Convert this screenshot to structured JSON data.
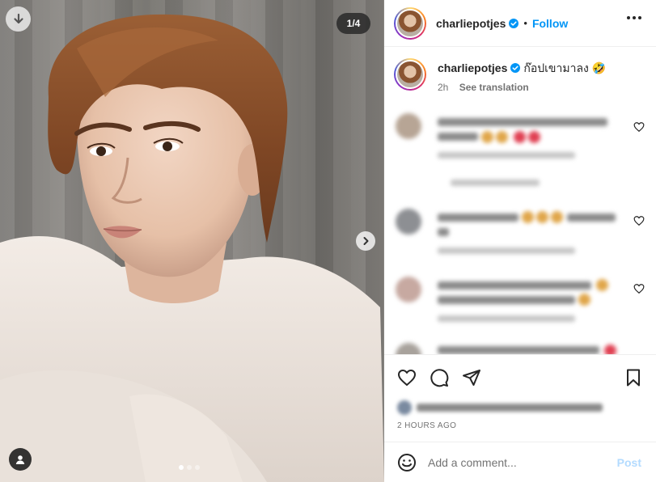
{
  "media": {
    "counter": "1/4",
    "carousel": {
      "total": 4,
      "active_index": 0
    },
    "icons": [
      "download-icon",
      "chevron-right-icon",
      "user-tag-icon"
    ]
  },
  "post": {
    "username": "charliepotjes",
    "separator": "•",
    "follow_label": "Follow",
    "caption_text": "ก๊อปเขามาลง 🤣",
    "caption_age": "2h",
    "see_translation": "See translation",
    "timestamp": "2 HOURS AGO"
  },
  "composer": {
    "placeholder": "Add a comment...",
    "post_label": "Post"
  },
  "colors": {
    "accent": "#0095f6",
    "post_disabled": "#b3dbff",
    "verified": "#0095f6",
    "text": "#262626",
    "muted": "#737373"
  }
}
